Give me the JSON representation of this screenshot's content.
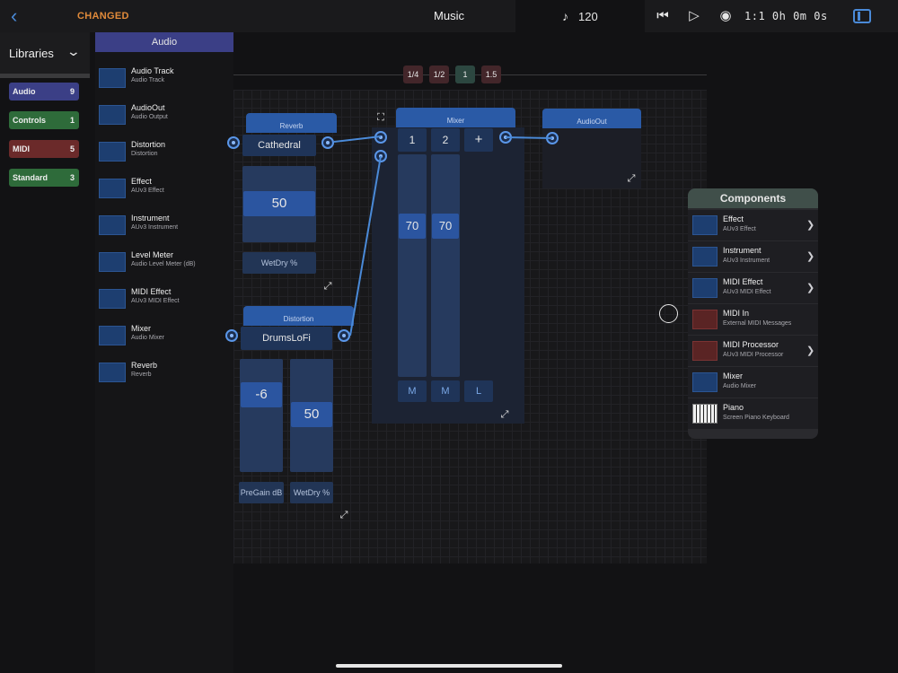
{
  "topbar": {
    "status": "CHANGED",
    "title": "Music",
    "tempo": "120",
    "time": "1:1  0h  0m  0s",
    "icons": [
      "chevron-left-icon",
      "music-note-icon",
      "skip-back-icon",
      "play-icon",
      "record-icon",
      "sidebar-icon"
    ]
  },
  "libraries": {
    "title": "Libraries",
    "categories": [
      {
        "name": "Audio",
        "count": "9",
        "color": "#3b3f86"
      },
      {
        "name": "Controls",
        "count": "1",
        "color": "#2e6b3a"
      },
      {
        "name": "MIDI",
        "count": "5",
        "color": "#6b2a2a"
      },
      {
        "name": "Standard",
        "count": "3",
        "color": "#2e6b3a"
      }
    ]
  },
  "audio_list": {
    "title": "Audio",
    "items": [
      {
        "name": "Audio Track",
        "sub": "Audio Track"
      },
      {
        "name": "AudioOut",
        "sub": "Audio Output"
      },
      {
        "name": "Distortion",
        "sub": "Distortion"
      },
      {
        "name": "Effect",
        "sub": "AUv3 Effect"
      },
      {
        "name": "Instrument",
        "sub": "AUv3 Instrument"
      },
      {
        "name": "Level Meter",
        "sub": "Audio Level Meter (dB)"
      },
      {
        "name": "MIDI Effect",
        "sub": "AUv3 MIDI Effect"
      },
      {
        "name": "Mixer",
        "sub": "Audio Mixer"
      },
      {
        "name": "Reverb",
        "sub": "Reverb"
      }
    ]
  },
  "zoom": [
    "1/4",
    "1/2",
    "1",
    "1.5"
  ],
  "nodes": {
    "reverb": {
      "title": "Reverb",
      "preset": "Cathedral",
      "value": "50",
      "param": "WetDry %"
    },
    "distortion": {
      "title": "Distortion",
      "preset": "DrumsLoFi",
      "value1": "-6",
      "value2": "50",
      "param1": "PreGain dB",
      "param2": "WetDry %"
    },
    "mixer": {
      "title": "Mixer",
      "ch1": "1",
      "ch2": "2",
      "add": "+",
      "val1": "70",
      "val2": "70",
      "m1": "M",
      "m2": "M",
      "l": "L"
    },
    "audioout": {
      "title": "AudioOut"
    }
  },
  "components": {
    "title": "Components",
    "items": [
      {
        "name": "Effect",
        "sub": "AUv3 Effect",
        "chevron": true
      },
      {
        "name": "Instrument",
        "sub": "AUv3 Instrument",
        "chevron": true
      },
      {
        "name": "MIDI Effect",
        "sub": "AUv3 MIDI Effect",
        "chevron": true
      },
      {
        "name": "MIDI In",
        "sub": "External MIDI Messages",
        "chevron": false
      },
      {
        "name": "MIDI Processor",
        "sub": "AUv3 MIDI Processor",
        "chevron": true
      },
      {
        "name": "Mixer",
        "sub": "Audio Mixer",
        "chevron": false
      },
      {
        "name": "Piano",
        "sub": "Screen Piano Keyboard",
        "chevron": false
      }
    ]
  }
}
